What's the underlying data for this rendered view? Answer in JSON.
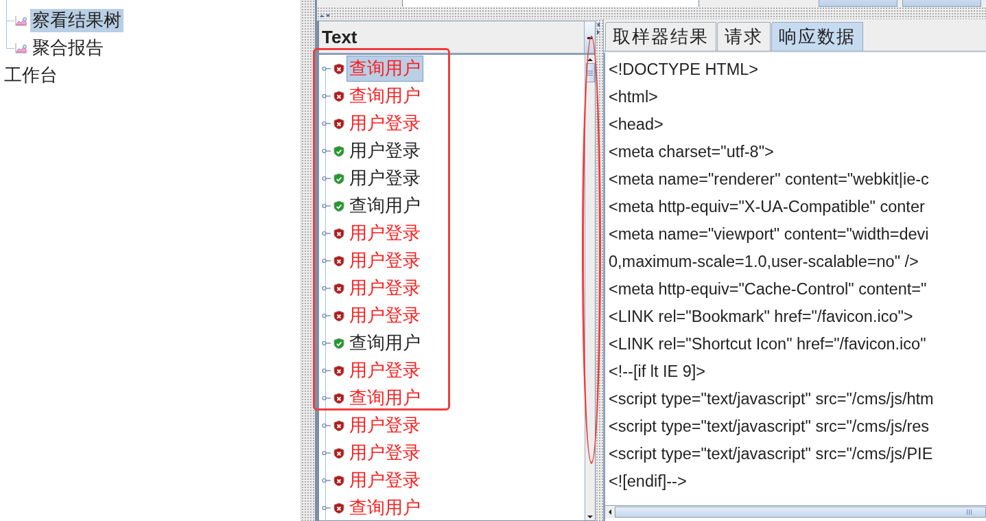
{
  "tree": {
    "items": [
      {
        "label": "察看结果树",
        "kind": "listener",
        "selected": true
      },
      {
        "label": "聚合报告",
        "kind": "listener",
        "selected": false
      },
      {
        "label": "工作台",
        "kind": "root",
        "selected": false
      }
    ]
  },
  "results": {
    "column": "Text",
    "rows": [
      {
        "label": "查询用户",
        "kind": "error",
        "selected": true
      },
      {
        "label": "查询用户",
        "kind": "error",
        "selected": false
      },
      {
        "label": "用户登录",
        "kind": "error",
        "selected": false
      },
      {
        "label": "用户登录",
        "kind": "success",
        "selected": false
      },
      {
        "label": "用户登录",
        "kind": "success",
        "selected": false
      },
      {
        "label": "查询用户",
        "kind": "success",
        "selected": false
      },
      {
        "label": "用户登录",
        "kind": "error",
        "selected": false
      },
      {
        "label": "用户登录",
        "kind": "error",
        "selected": false
      },
      {
        "label": "用户登录",
        "kind": "error",
        "selected": false
      },
      {
        "label": "用户登录",
        "kind": "error",
        "selected": false
      },
      {
        "label": "查询用户",
        "kind": "success",
        "selected": false
      },
      {
        "label": "用户登录",
        "kind": "error",
        "selected": false
      },
      {
        "label": "查询用户",
        "kind": "error",
        "selected": false
      },
      {
        "label": "用户登录",
        "kind": "error",
        "selected": false
      },
      {
        "label": "用户登录",
        "kind": "error",
        "selected": false
      },
      {
        "label": "用户登录",
        "kind": "error",
        "selected": false
      },
      {
        "label": "查询用户",
        "kind": "error",
        "selected": false
      }
    ]
  },
  "detail": {
    "tabs": [
      {
        "label": "取样器结果",
        "selected": false
      },
      {
        "label": "请求",
        "selected": false
      },
      {
        "label": "响应数据",
        "selected": true
      }
    ],
    "lines": [
      "<!DOCTYPE HTML>",
      "<html>",
      "<head>",
      "<meta charset=\"utf-8\">",
      "<meta name=\"renderer\" content=\"webkit|ie-c",
      "<meta http-equiv=\"X-UA-Compatible\" conter",
      "<meta name=\"viewport\" content=\"width=devi",
      "0,maximum-scale=1.0,user-scalable=no\" />",
      "<meta http-equiv=\"Cache-Control\" content=\"",
      "<LINK rel=\"Bookmark\" href=\"/favicon.ico\">",
      "<LINK rel=\"Shortcut Icon\" href=\"/favicon.ico\"",
      "<!--[if lt IE 9]>",
      "<script type=\"text/javascript\" src=\"/cms/js/htm",
      "<script type=\"text/javascript\" src=\"/cms/js/res",
      "<script type=\"text/javascript\" src=\"/cms/js/PIE",
      "<![endif]-->"
    ]
  },
  "annotations": [
    {
      "kind": "rectangle",
      "color": "#f03c3c"
    },
    {
      "kind": "ellipse",
      "color": "#f03c3c"
    }
  ]
}
